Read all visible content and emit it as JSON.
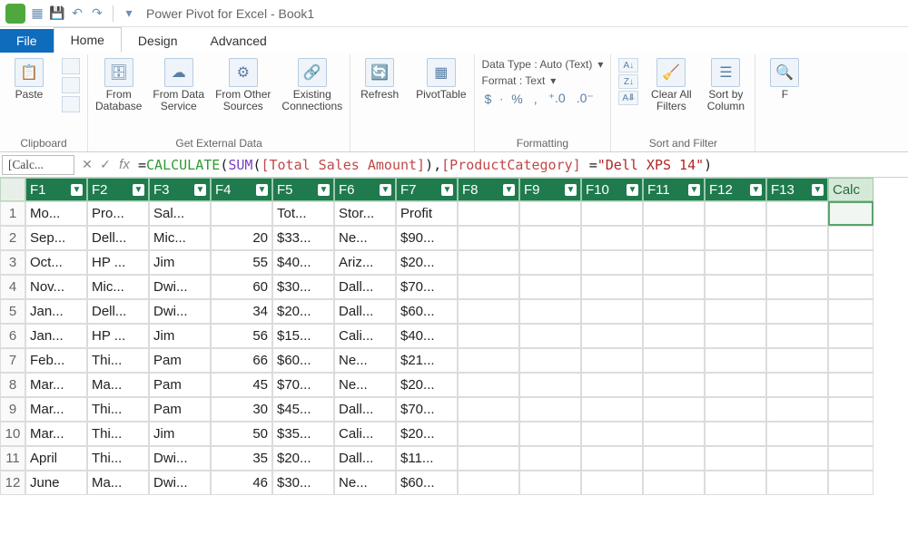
{
  "title": "Power Pivot for Excel - Book1",
  "qat": {
    "save": "save-icon",
    "undo": "undo-icon",
    "redo": "redo-icon"
  },
  "tabs": {
    "file": "File",
    "home": "Home",
    "design": "Design",
    "advanced": "Advanced"
  },
  "ribbon": {
    "clipboard": {
      "paste": "Paste",
      "label": "Clipboard"
    },
    "external": {
      "db": "From\nDatabase",
      "svc": "From Data\nService",
      "other": "From Other\nSources",
      "existing": "Existing\nConnections",
      "label": "Get External Data"
    },
    "refresh": "Refresh",
    "pivot": "PivotTable",
    "format": {
      "datatype": "Data Type : Auto (Text)",
      "fmt": "Format : Text",
      "sym_dollar": "$",
      "sym_pct": "%",
      "sym_comma": ",",
      "sym_inc": ".00→",
      "sym_dec": "→.00",
      "label": "Formatting"
    },
    "sortfilter": {
      "clear": "Clear All\nFilters",
      "sortby": "Sort by\nColumn",
      "label": "Sort and Filter"
    }
  },
  "namebox": "[Calc...",
  "formula": {
    "eq": "=",
    "fn1": "CALCULATE",
    "p1": "(",
    "fn2": "SUM",
    "p2": "(",
    "col1": "[Total Sales Amount]",
    "p3": "),",
    "col2": "[ProductCategory]",
    "eq2": " =",
    "str": "\"Dell XPS 14\"",
    "p4": ")"
  },
  "columns": [
    "F1",
    "F2",
    "F3",
    "F4",
    "F5",
    "F6",
    "F7",
    "F8",
    "F9",
    "F10",
    "F11",
    "F12",
    "F13"
  ],
  "calc_col": "Calc",
  "rows": [
    {
      "n": 1,
      "c": [
        "Mo...",
        "Pro...",
        "Sal...",
        "",
        "Tot...",
        "Stor...",
        "Profit",
        "",
        "",
        "",
        "",
        "",
        ""
      ]
    },
    {
      "n": 2,
      "c": [
        "Sep...",
        "Dell...",
        "Mic...",
        "20",
        "$33...",
        "Ne...",
        "$90...",
        "",
        "",
        "",
        "",
        "",
        ""
      ]
    },
    {
      "n": 3,
      "c": [
        "Oct...",
        "HP ...",
        "Jim",
        "55",
        "$40...",
        "Ariz...",
        "$20...",
        "",
        "",
        "",
        "",
        "",
        ""
      ]
    },
    {
      "n": 4,
      "c": [
        "Nov...",
        "Mic...",
        "Dwi...",
        "60",
        "$30...",
        "Dall...",
        "$70...",
        "",
        "",
        "",
        "",
        "",
        ""
      ]
    },
    {
      "n": 5,
      "c": [
        "Jan...",
        "Dell...",
        "Dwi...",
        "34",
        "$20...",
        "Dall...",
        "$60...",
        "",
        "",
        "",
        "",
        "",
        ""
      ]
    },
    {
      "n": 6,
      "c": [
        "Jan...",
        "HP ...",
        "Jim",
        "56",
        "$15...",
        "Cali...",
        "$40...",
        "",
        "",
        "",
        "",
        "",
        ""
      ]
    },
    {
      "n": 7,
      "c": [
        "Feb...",
        "Thi...",
        "Pam",
        "66",
        "$60...",
        "Ne...",
        "$21...",
        "",
        "",
        "",
        "",
        "",
        ""
      ]
    },
    {
      "n": 8,
      "c": [
        "Mar...",
        "Ma...",
        "Pam",
        "45",
        "$70...",
        "Ne...",
        "$20...",
        "",
        "",
        "",
        "",
        "",
        ""
      ]
    },
    {
      "n": 9,
      "c": [
        "Mar...",
        "Thi...",
        "Pam",
        "30",
        "$45...",
        "Dall...",
        "$70...",
        "",
        "",
        "",
        "",
        "",
        ""
      ]
    },
    {
      "n": 10,
      "c": [
        "Mar...",
        "Thi...",
        "Jim",
        "50",
        "$35...",
        "Cali...",
        "$20...",
        "",
        "",
        "",
        "",
        "",
        ""
      ]
    },
    {
      "n": 11,
      "c": [
        "April",
        "Thi...",
        "Dwi...",
        "35",
        "$20...",
        "Dall...",
        "$11...",
        "",
        "",
        "",
        "",
        "",
        ""
      ]
    },
    {
      "n": 12,
      "c": [
        "June",
        "Ma...",
        "Dwi...",
        "46",
        "$30...",
        "Ne...",
        "$60...",
        "",
        "",
        "",
        "",
        "",
        ""
      ]
    }
  ]
}
